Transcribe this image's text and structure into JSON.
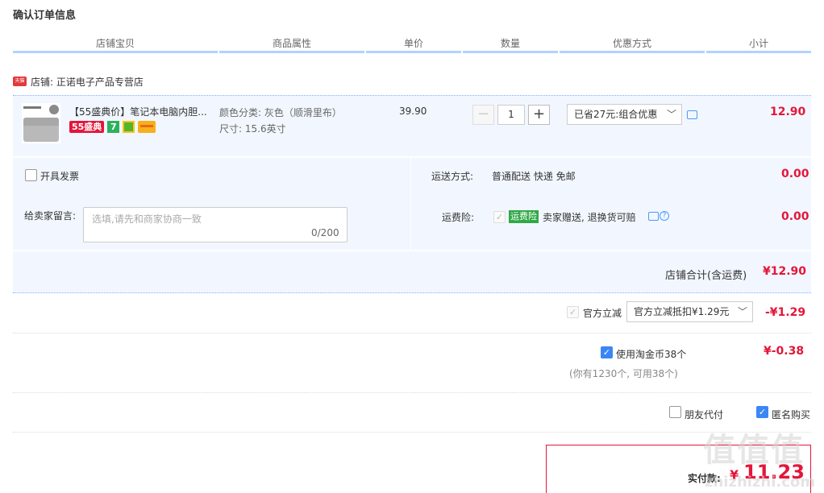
{
  "page_title": "确认订单信息",
  "table_headers": [
    "店铺宝贝",
    "商品属性",
    "单价",
    "数量",
    "优惠方式",
    "小计"
  ],
  "shop": {
    "badge_text": "天猫",
    "label": "店铺: 正诺电子产品专营店"
  },
  "item": {
    "title": "【55盛典价】笔记本电脑内胆...",
    "badge_55": "55盛典",
    "badge_7": "7",
    "attr_color": "颜色分类: 灰色（顺滑里布）",
    "attr_size": "尺寸: 15.6英寸",
    "unit_price": "39.90",
    "qty_minus": "−",
    "qty": "1",
    "qty_plus": "+",
    "promo": "已省27元:组合优惠",
    "subtotal": "12.90"
  },
  "invoice": {
    "label": "开具发票"
  },
  "shipping": {
    "label": "运送方式:",
    "value": "普通配送 快递 免邮",
    "amount": "0.00"
  },
  "memo": {
    "label": "给卖家留言:",
    "placeholder": "选填,请先和商家协商一致",
    "count": "0/200"
  },
  "freight_ins": {
    "label": "运费险:",
    "badge": "运费险",
    "text": "卖家赠送, 退换货可赔",
    "amount": "0.00"
  },
  "shop_total": {
    "label": "店铺合计(含运费)",
    "amount": "¥12.90"
  },
  "official_discount": {
    "label": "官方立减",
    "select": "官方立减抵扣¥1.29元",
    "amount": "-¥1.29"
  },
  "taobao_coins": {
    "label": "使用淘金币38个",
    "note": "(你有1230个, 可用38个)",
    "amount": "¥-0.38"
  },
  "options": {
    "friend_pay": "朋友代付",
    "anonymous": "匿名购买"
  },
  "payment": {
    "label": "实付款:",
    "currency": "¥",
    "amount": "11.23"
  },
  "watermark": {
    "main": "值值值",
    "sub": "zhizhizhi.com"
  },
  "colors": {
    "accent_red": "#e4163a",
    "blue_header": "#b2d1ff",
    "block_bg": "#f2f7ff",
    "checkbox_blue": "#3a86f5"
  },
  "icons": [
    "tmall-icon",
    "chat-bubble-icon",
    "chevron-down-icon",
    "question-icon",
    "checkbox-icon"
  ]
}
